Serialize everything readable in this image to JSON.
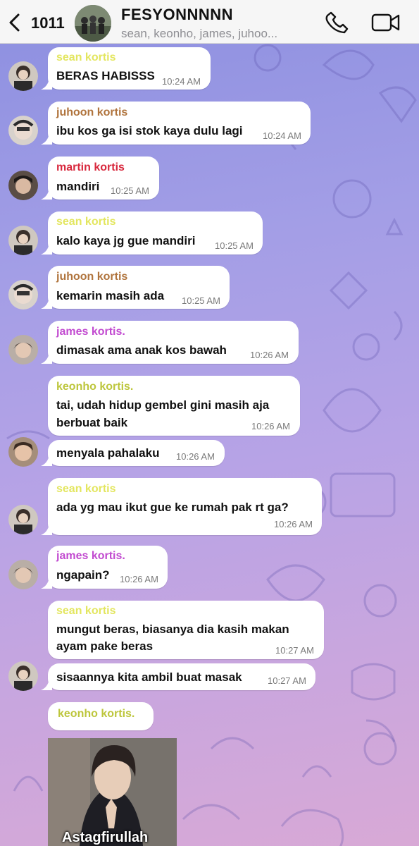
{
  "header": {
    "back_count": "1011",
    "title": "FESYONNNNN",
    "members": "sean, keonho, james, juhoo..."
  },
  "messages": [
    {
      "sender": "sean kortis",
      "text": "BERAS HABISSS",
      "time": "10:24 AM"
    },
    {
      "sender": "juhoon kortis",
      "text": "ibu kos ga isi stok kaya dulu lagi",
      "time": "10:24 AM"
    },
    {
      "sender": "martin kortis",
      "text": "mandiri",
      "time": "10:25 AM"
    },
    {
      "sender": "sean kortis",
      "text": "kalo kaya jg gue mandiri",
      "time": "10:25 AM"
    },
    {
      "sender": "juhoon kortis",
      "text": "kemarin masih ada",
      "time": "10:25 AM"
    },
    {
      "sender": "james kortis.",
      "text": "dimasak ama anak kos bawah",
      "time": "10:26 AM"
    },
    {
      "sender": "keonho kortis.",
      "text_line1": "tai, udah hidup gembel gini masih aja",
      "text_line2": "berbuat baik",
      "time": "10:26 AM"
    },
    {
      "text": "menyala pahalaku",
      "time": "10:26 AM"
    },
    {
      "sender": "sean kortis",
      "text": "ada yg mau ikut gue ke rumah pak rt ga?",
      "time": "10:26 AM"
    },
    {
      "sender": "james kortis.",
      "text": "ngapain?",
      "time": "10:26 AM"
    },
    {
      "sender": "sean kortis",
      "text_line1": "mungut beras, biasanya dia kasih makan",
      "text_line2": "ayam pake beras",
      "time": "10:27 AM"
    },
    {
      "text": "sisaannya kita ambil buat masak",
      "time": "10:27 AM"
    },
    {
      "sender": "keonho kortis.",
      "photo_caption": "Astagfirullah"
    }
  ],
  "colors": {
    "sean": "#e3e65f",
    "juhoon": "#b0743d",
    "martin": "#d8283d",
    "james": "#c24bd0",
    "keonho": "#bdc63c"
  }
}
